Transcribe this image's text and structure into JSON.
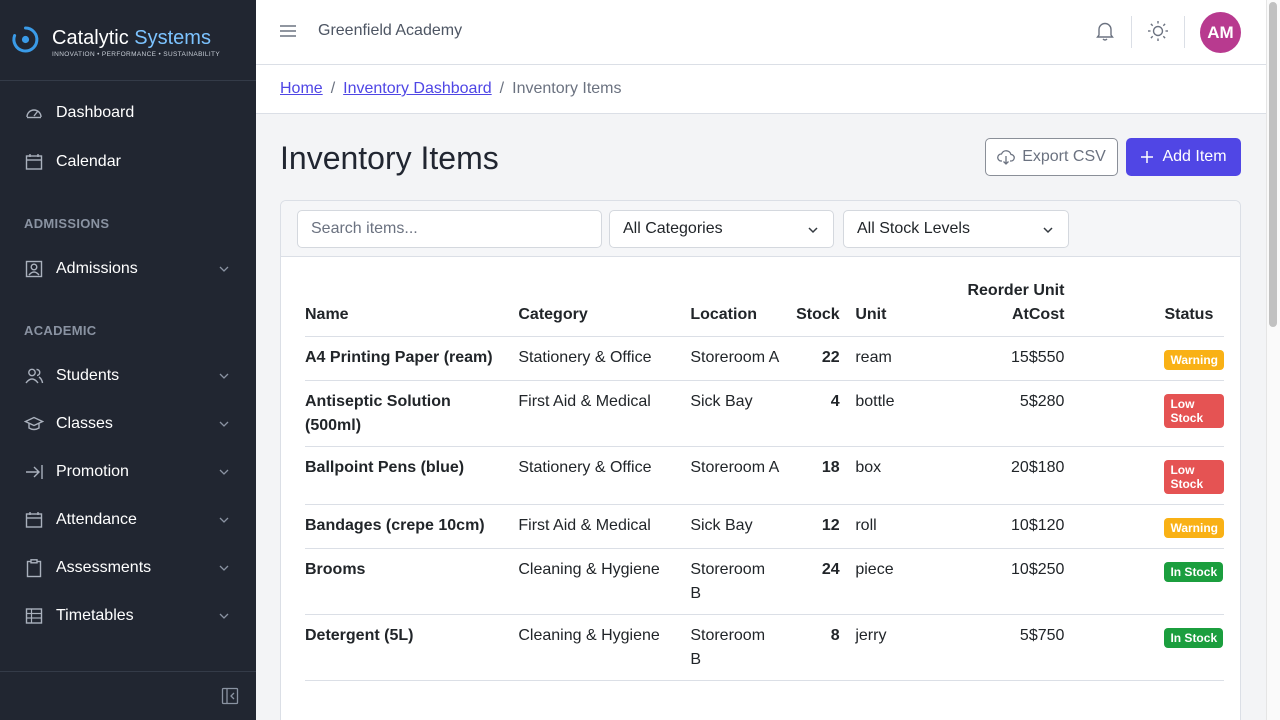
{
  "brand": {
    "name_part1": "Catalytic",
    "name_part2": "Systems",
    "tagline": "INNOVATION • PERFORMANCE • SUSTAINABILITY",
    "accent_color": "#7cc3ff"
  },
  "sidebar": {
    "top_items": [
      {
        "label": "Dashboard",
        "icon": "speedometer-icon"
      },
      {
        "label": "Calendar",
        "icon": "calendar-icon"
      }
    ],
    "sections": [
      {
        "title": "ADMISSIONS",
        "items": [
          {
            "label": "Admissions",
            "icon": "id-badge-icon"
          }
        ]
      },
      {
        "title": "ACADEMIC",
        "items": [
          {
            "label": "Students",
            "icon": "people-icon"
          },
          {
            "label": "Classes",
            "icon": "graduation-cap-icon"
          },
          {
            "label": "Promotion",
            "icon": "arrow-right-icon"
          },
          {
            "label": "Attendance",
            "icon": "calendar-icon"
          },
          {
            "label": "Assessments",
            "icon": "clipboard-icon"
          },
          {
            "label": "Timetables",
            "icon": "table-icon"
          }
        ]
      }
    ]
  },
  "header": {
    "org_name": "Greenfield Academy",
    "avatar_initials": "AM",
    "avatar_color": "#b83a8f"
  },
  "breadcrumb": {
    "home": "Home",
    "parent": "Inventory Dashboard",
    "current": "Inventory Items"
  },
  "page": {
    "title": "Inventory Items",
    "export_label": "Export CSV",
    "add_label": "Add Item",
    "primary_color": "#5046e5"
  },
  "filters": {
    "search_placeholder": "Search items...",
    "category_selected": "All Categories",
    "stock_selected": "All Stock Levels"
  },
  "table": {
    "headers": {
      "name": "Name",
      "category": "Category",
      "location": "Location",
      "stock": "Stock",
      "unit": "Unit",
      "reorder_line1": "Reorder",
      "reorder_line2": "At",
      "cost_line1": "Unit",
      "cost_line2": "Cost",
      "status": "Status"
    },
    "rows": [
      {
        "name": "A4 Printing Paper (ream)",
        "category": "Stationery & Office",
        "location": "Storeroom A",
        "stock": "22",
        "unit": "ream",
        "reorder": "15",
        "cost": "$550",
        "status": "Warning"
      },
      {
        "name": "Antiseptic Solution (500ml)",
        "category": "First Aid & Medical",
        "location": "Sick Bay",
        "stock": "4",
        "unit": "bottle",
        "reorder": "5",
        "cost": "$280",
        "status": "Low Stock"
      },
      {
        "name": "Ballpoint Pens (blue)",
        "category": "Stationery & Office",
        "location": "Storeroom A",
        "stock": "18",
        "unit": "box",
        "reorder": "20",
        "cost": "$180",
        "status": "Low Stock"
      },
      {
        "name": "Bandages (crepe 10cm)",
        "category": "First Aid & Medical",
        "location": "Sick Bay",
        "stock": "12",
        "unit": "roll",
        "reorder": "10",
        "cost": "$120",
        "status": "Warning"
      },
      {
        "name": "Brooms",
        "category": "Cleaning & Hygiene",
        "location": "Storeroom B",
        "stock": "24",
        "unit": "piece",
        "reorder": "10",
        "cost": "$250",
        "status": "In Stock"
      },
      {
        "name": "Detergent (5L)",
        "category": "Cleaning & Hygiene",
        "location": "Storeroom B",
        "stock": "8",
        "unit": "jerry",
        "reorder": "5",
        "cost": "$750",
        "status": "In Stock"
      }
    ]
  }
}
